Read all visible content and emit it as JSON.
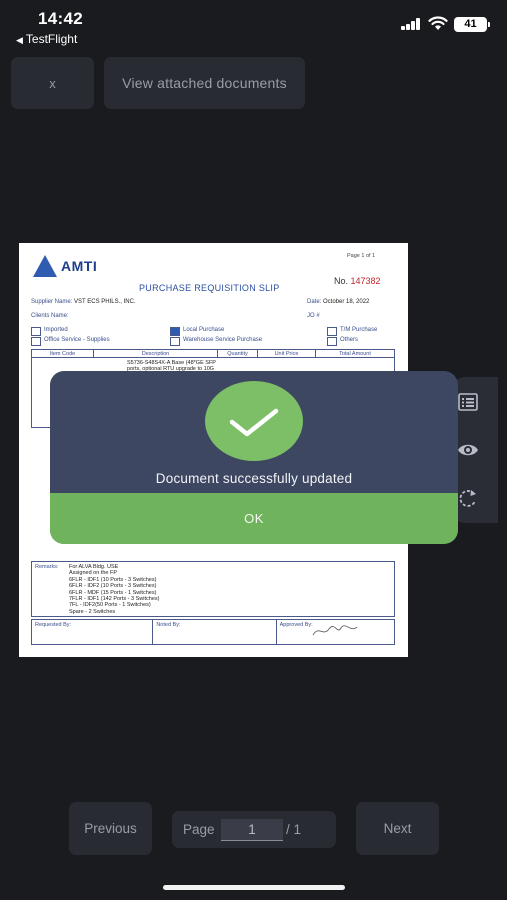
{
  "status_bar": {
    "time": "14:42",
    "back_label": "TestFlight",
    "battery": "41"
  },
  "header": {
    "close_label": "x",
    "view_docs_label": "View attached documents"
  },
  "document": {
    "logo_text": "AMTI",
    "page_of": "Page 1 of 1",
    "title": "PURCHASE REQUISITION SLIP",
    "no_label": "No.",
    "no_value": "147382",
    "supplier_label": "Supplier Name:",
    "supplier_value": "VST ECS PHILS., INC.",
    "date_label": "Date:",
    "date_value": "October 18, 2022",
    "clients_label": "Clients Name:",
    "jo_label": "JO #",
    "imported": "Imported",
    "office_service": "Office Service - Supplies",
    "local_purchase": "Local Purchase",
    "warehouse": "Warehouse Service Purchase",
    "tm_purchase": "T/M Purchase",
    "others": "Others",
    "col_item": "Item Code",
    "col_desc": "Description",
    "col_qty": "Quantity",
    "col_unit": "Unit Price",
    "col_total": "Total Amount",
    "desc_line1": "S5736-S48S4X-A Base (48*GE SFP",
    "desc_line2": "ports, optional RTU upgrade to 10G",
    "remarks_label": "Remarks:",
    "remarks": [
      "For ALVA Bldg. USE",
      "Assigned on the FP",
      "6FLR - IDF1 (10 Ports - 3 Switches)",
      "6FLR - IDF2 (10 Ports - 3 Switches)",
      "6FLR - MDF (15 Ports - 1 Switches)",
      "7FLR - IDF1 (142 Ports - 3 Switches)",
      "7FL - IDF2(50 Ports - 1 Switches)",
      "Spare - 2 Switches"
    ],
    "requested_by": "Requested By:",
    "noted_by": "Noted By:",
    "approved_by": "Approved By:"
  },
  "modal": {
    "message": "Document successfully updated",
    "ok_label": "OK",
    "icon": "check-icon"
  },
  "side_panel": {
    "icons": [
      "list-icon",
      "eye-icon",
      "rotate-icon"
    ]
  },
  "pager": {
    "previous_label": "Previous",
    "next_label": "Next",
    "page_label": "Page",
    "page_value": "1",
    "total_label": "/ 1"
  },
  "colors": {
    "background": "#1a1b1f",
    "button": "#292b33",
    "modal": "#3d4762",
    "success": "#6fb35c"
  }
}
